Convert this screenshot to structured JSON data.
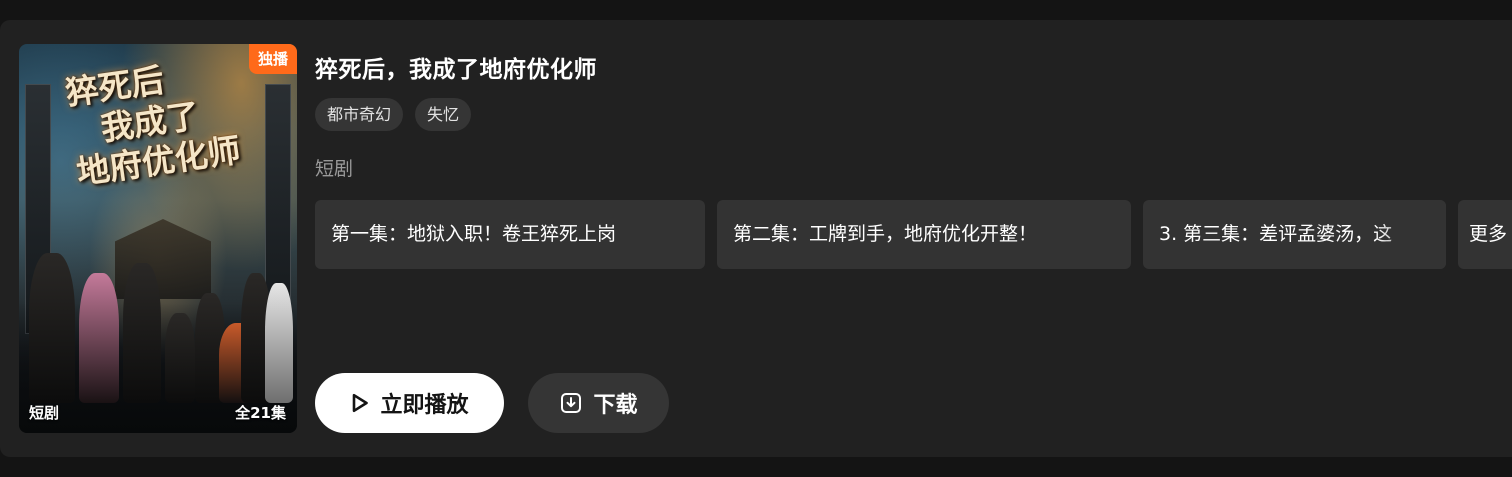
{
  "drama": {
    "title": "猝死后，我成了地府优化师",
    "tags": [
      "都市奇幻",
      "失忆"
    ],
    "category": "短剧",
    "poster": {
      "badge": "独播",
      "title_lines": [
        "猝死后",
        "我成了",
        "地府优化师"
      ],
      "type_label": "短剧",
      "episode_count": "全21集"
    }
  },
  "episodes": [
    {
      "label": "第一集：地狱入职！卷王猝死上岗"
    },
    {
      "label": "第二集：工牌到手，地府优化开整！"
    },
    {
      "label": "3. 第三集：差评孟婆汤，这"
    },
    {
      "label": "更多"
    }
  ],
  "actions": {
    "play_label": "立即播放",
    "play_icon": "play-icon",
    "download_label": "下载",
    "download_icon": "download-icon"
  },
  "colors": {
    "background": "#141414",
    "card": "#212121",
    "accent": "#ff6a1a",
    "chip": "#353535",
    "episode_bg": "#333333"
  }
}
